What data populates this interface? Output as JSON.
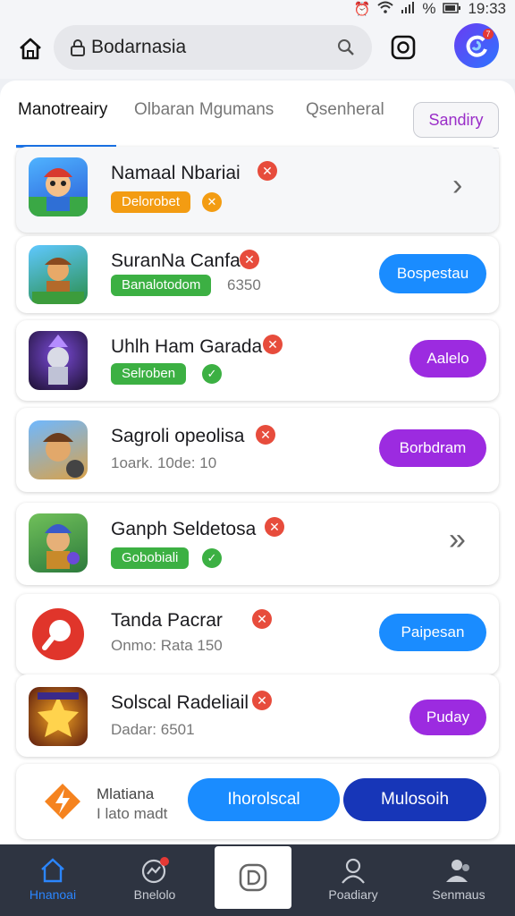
{
  "status": {
    "time": "19:33",
    "battery": "%"
  },
  "topbar": {
    "url": "Bodarnasia"
  },
  "tabs": [
    {
      "label": "Manotreairy"
    },
    {
      "label": "Olbaran Mgumans"
    },
    {
      "label": "Qsenheral"
    }
  ],
  "tab_button": "Sandiry",
  "cards": [
    {
      "title": "Namaal Nbariai",
      "pill": "Delorobet"
    },
    {
      "title": "SuranNa Canfa",
      "pill": "Banalotodom",
      "pill_extra": "6350",
      "action": "Bospestau"
    },
    {
      "title": "Uhlh Ham Garada",
      "pill": "Selroben",
      "action": "Aalelo"
    },
    {
      "title": "Sagroli opeolisa",
      "sub": "1oark. 10de: 10",
      "action": "Borbdram"
    },
    {
      "title": "Ganph Seldetosa",
      "pill": "Gobobiali"
    },
    {
      "title": "Tanda Pacrar",
      "sub": "Onmo: Rata 150",
      "action": "Paipesan"
    },
    {
      "title": "Solscal Radeliail",
      "sub": "Dadar: 6501",
      "action": "Puday"
    }
  ],
  "promo": {
    "line1": "Mlatiana",
    "line2": "I lato madt",
    "button_primary": "Ihorolscal",
    "button_secondary": "Mulosoih"
  },
  "nav": [
    {
      "label": "Hnanoai"
    },
    {
      "label": "Bnelolo"
    },
    {
      "label": "Poadiary"
    },
    {
      "label": "Senmaus"
    }
  ],
  "colors": {
    "accent": "#1a8cff",
    "purple": "#9c2be0",
    "danger": "#e74c3c",
    "green": "#3cb043",
    "orange": "#f39c12",
    "navbar": "#2e3441"
  }
}
